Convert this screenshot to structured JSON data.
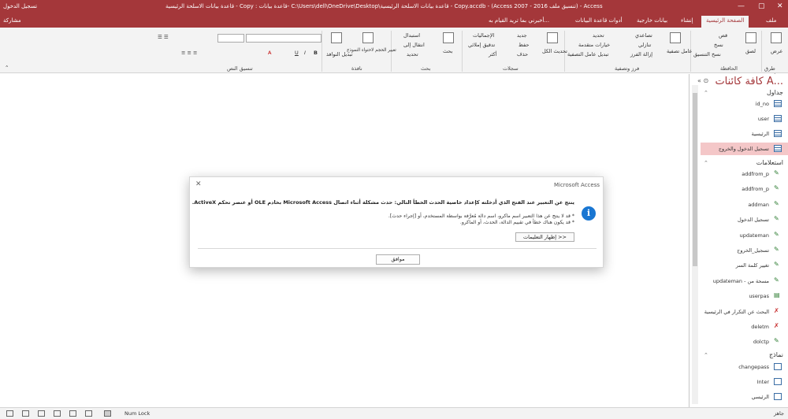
{
  "titlebar": {
    "title": "قاعدة بيانات الاسلحة الرئيسية - Copy : قاعدة بيانات- C:\\Users\\dell\\OneDrive\\Desktop\\قاعدة بيانات الاسلحة الرئيسية - Copy.accdb - (Access 2007 - 2016 تنسيق ملف) - Access",
    "signin": "تسجيل الدخول",
    "minimize": "—",
    "restore": "▢",
    "close": "✕"
  },
  "tabs": {
    "file": "ملف",
    "home": "الصفحة الرئيسية",
    "create": "إنشاء",
    "external": "بيانات خارجية",
    "dbtools": "أدوات قاعدة البيانات",
    "tellme": "أخبرني بما تريد القيام به...",
    "share": "مشاركة"
  },
  "ribbon": {
    "views_label": "طرق عرض",
    "view": "عرض",
    "clipboard_label": "الحافظة",
    "paste": "لصق",
    "cut": "قص",
    "copy": "نسخ",
    "format_painter": "نسخ التنسيق",
    "sort_filter_label": "فرز وتصفية",
    "filter": "عامل تصفية",
    "ascending": "تصاعدي",
    "descending": "تنازلي",
    "remove_sort": "إزالة الفرز",
    "selection": "تحديد",
    "advanced": "خيارات متقدمة",
    "toggle_filter": "تبديل عامل التصفية",
    "records_label": "سجلات",
    "refresh_all": "تحديث الكل",
    "new": "جديد",
    "save": "حفظ",
    "delete": "حذف",
    "totals": "الإجماليات",
    "spelling": "تدقيق إملائي",
    "more": "أكثر",
    "find_label": "بحث",
    "find": "بحث",
    "replace": "استبدال",
    "goto": "انتقال إلى",
    "select": "تحديد",
    "window_label": "نافذة",
    "size_to_fit": "تغيير الحجم لاحتواء النموذج",
    "switch_windows": "تبديل النوافذ",
    "text_format_label": "تنسيق النص"
  },
  "nav": {
    "title": "كافة كائنات A...",
    "sections": {
      "tables": "جداول",
      "queries": "استعلامات",
      "forms": "نماذج"
    },
    "tables": [
      {
        "label": "id_no"
      },
      {
        "label": "user"
      },
      {
        "label": "الرئيسية"
      },
      {
        "label": "تسجيل الدخول والخروج",
        "selected": true
      }
    ],
    "queries": [
      {
        "label": "addfrom_p",
        "kind": "append"
      },
      {
        "label": "addfrom_p",
        "kind": "append"
      },
      {
        "label": "addman",
        "kind": "append"
      },
      {
        "label": "تسجيل الدخول",
        "kind": "append"
      },
      {
        "label": "updateman",
        "kind": "update"
      },
      {
        "label": "تسجيل_الخروج",
        "kind": "update"
      },
      {
        "label": "تغيير كلمة السر",
        "kind": "update"
      },
      {
        "label": "updateman - مسحة من",
        "kind": "update"
      },
      {
        "label": "userpas",
        "kind": "select"
      },
      {
        "label": "البحث عن التكرار في الرئيسية",
        "kind": "delete"
      },
      {
        "label": "deletm",
        "kind": "delete"
      },
      {
        "label": "dolctp",
        "kind": "update"
      }
    ],
    "forms": [
      {
        "label": "changepass"
      },
      {
        "label": "Inter"
      },
      {
        "label": "الرئيسي"
      }
    ]
  },
  "dialog": {
    "title": "Microsoft Access",
    "close": "✕",
    "message": "ينتج عن التعبير عند الفتح الذي أدخلته كإعداد خاصية الحدث الخطأ التالي: حدث مشكلة أثناء اتصال Microsoft Access بخادم OLE أو عنصر تحكم ActiveX.",
    "bullet1": "* قد لا ينتج عن هذا التعبير اسم ماكرو، اسم دالة مُعرَّفة بواسطة المستخدم، أو [إجراء حدث].",
    "bullet2": "* قد يكون هناك خطأ في تقييم الدالة، الحدث، أو الماكرو.",
    "show_help": "إظهار التعليمات >>",
    "ok": "موافق"
  },
  "status": {
    "ready": "جاهز",
    "numlock": "Num Lock"
  }
}
